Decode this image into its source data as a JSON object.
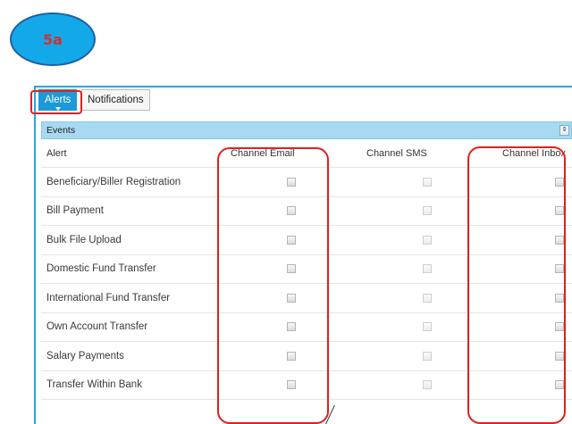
{
  "step": {
    "label": "5a"
  },
  "tabs": [
    {
      "label": "Alerts",
      "active": true
    },
    {
      "label": "Notifications",
      "active": false
    }
  ],
  "events": {
    "title": "Events",
    "toggle_icon": "double-chevron-icon"
  },
  "table": {
    "headers": {
      "alert": "Alert",
      "email": "Channel Email",
      "sms": "Channel SMS",
      "inbox": "Channel Inbox"
    },
    "rows": [
      {
        "name": "Beneficiary/Biller Registration",
        "email": false,
        "sms": false,
        "inbox": false
      },
      {
        "name": "Bill Payment",
        "email": false,
        "sms": false,
        "inbox": false
      },
      {
        "name": "Bulk File Upload",
        "email": false,
        "sms": false,
        "inbox": false
      },
      {
        "name": "Domestic Fund Transfer",
        "email": false,
        "sms": false,
        "inbox": false
      },
      {
        "name": "International Fund Transfer",
        "email": false,
        "sms": false,
        "inbox": false
      },
      {
        "name": "Own Account Transfer",
        "email": false,
        "sms": false,
        "inbox": false
      },
      {
        "name": "Salary Payments",
        "email": false,
        "sms": false,
        "inbox": false
      },
      {
        "name": "Transfer Within Bank",
        "email": false,
        "sms": false,
        "inbox": false
      }
    ]
  },
  "colors": {
    "accent": "#1a9ad9",
    "annotation": "#e02020",
    "badge": "#13a9e8",
    "events_bar": "#a7d9f1"
  }
}
